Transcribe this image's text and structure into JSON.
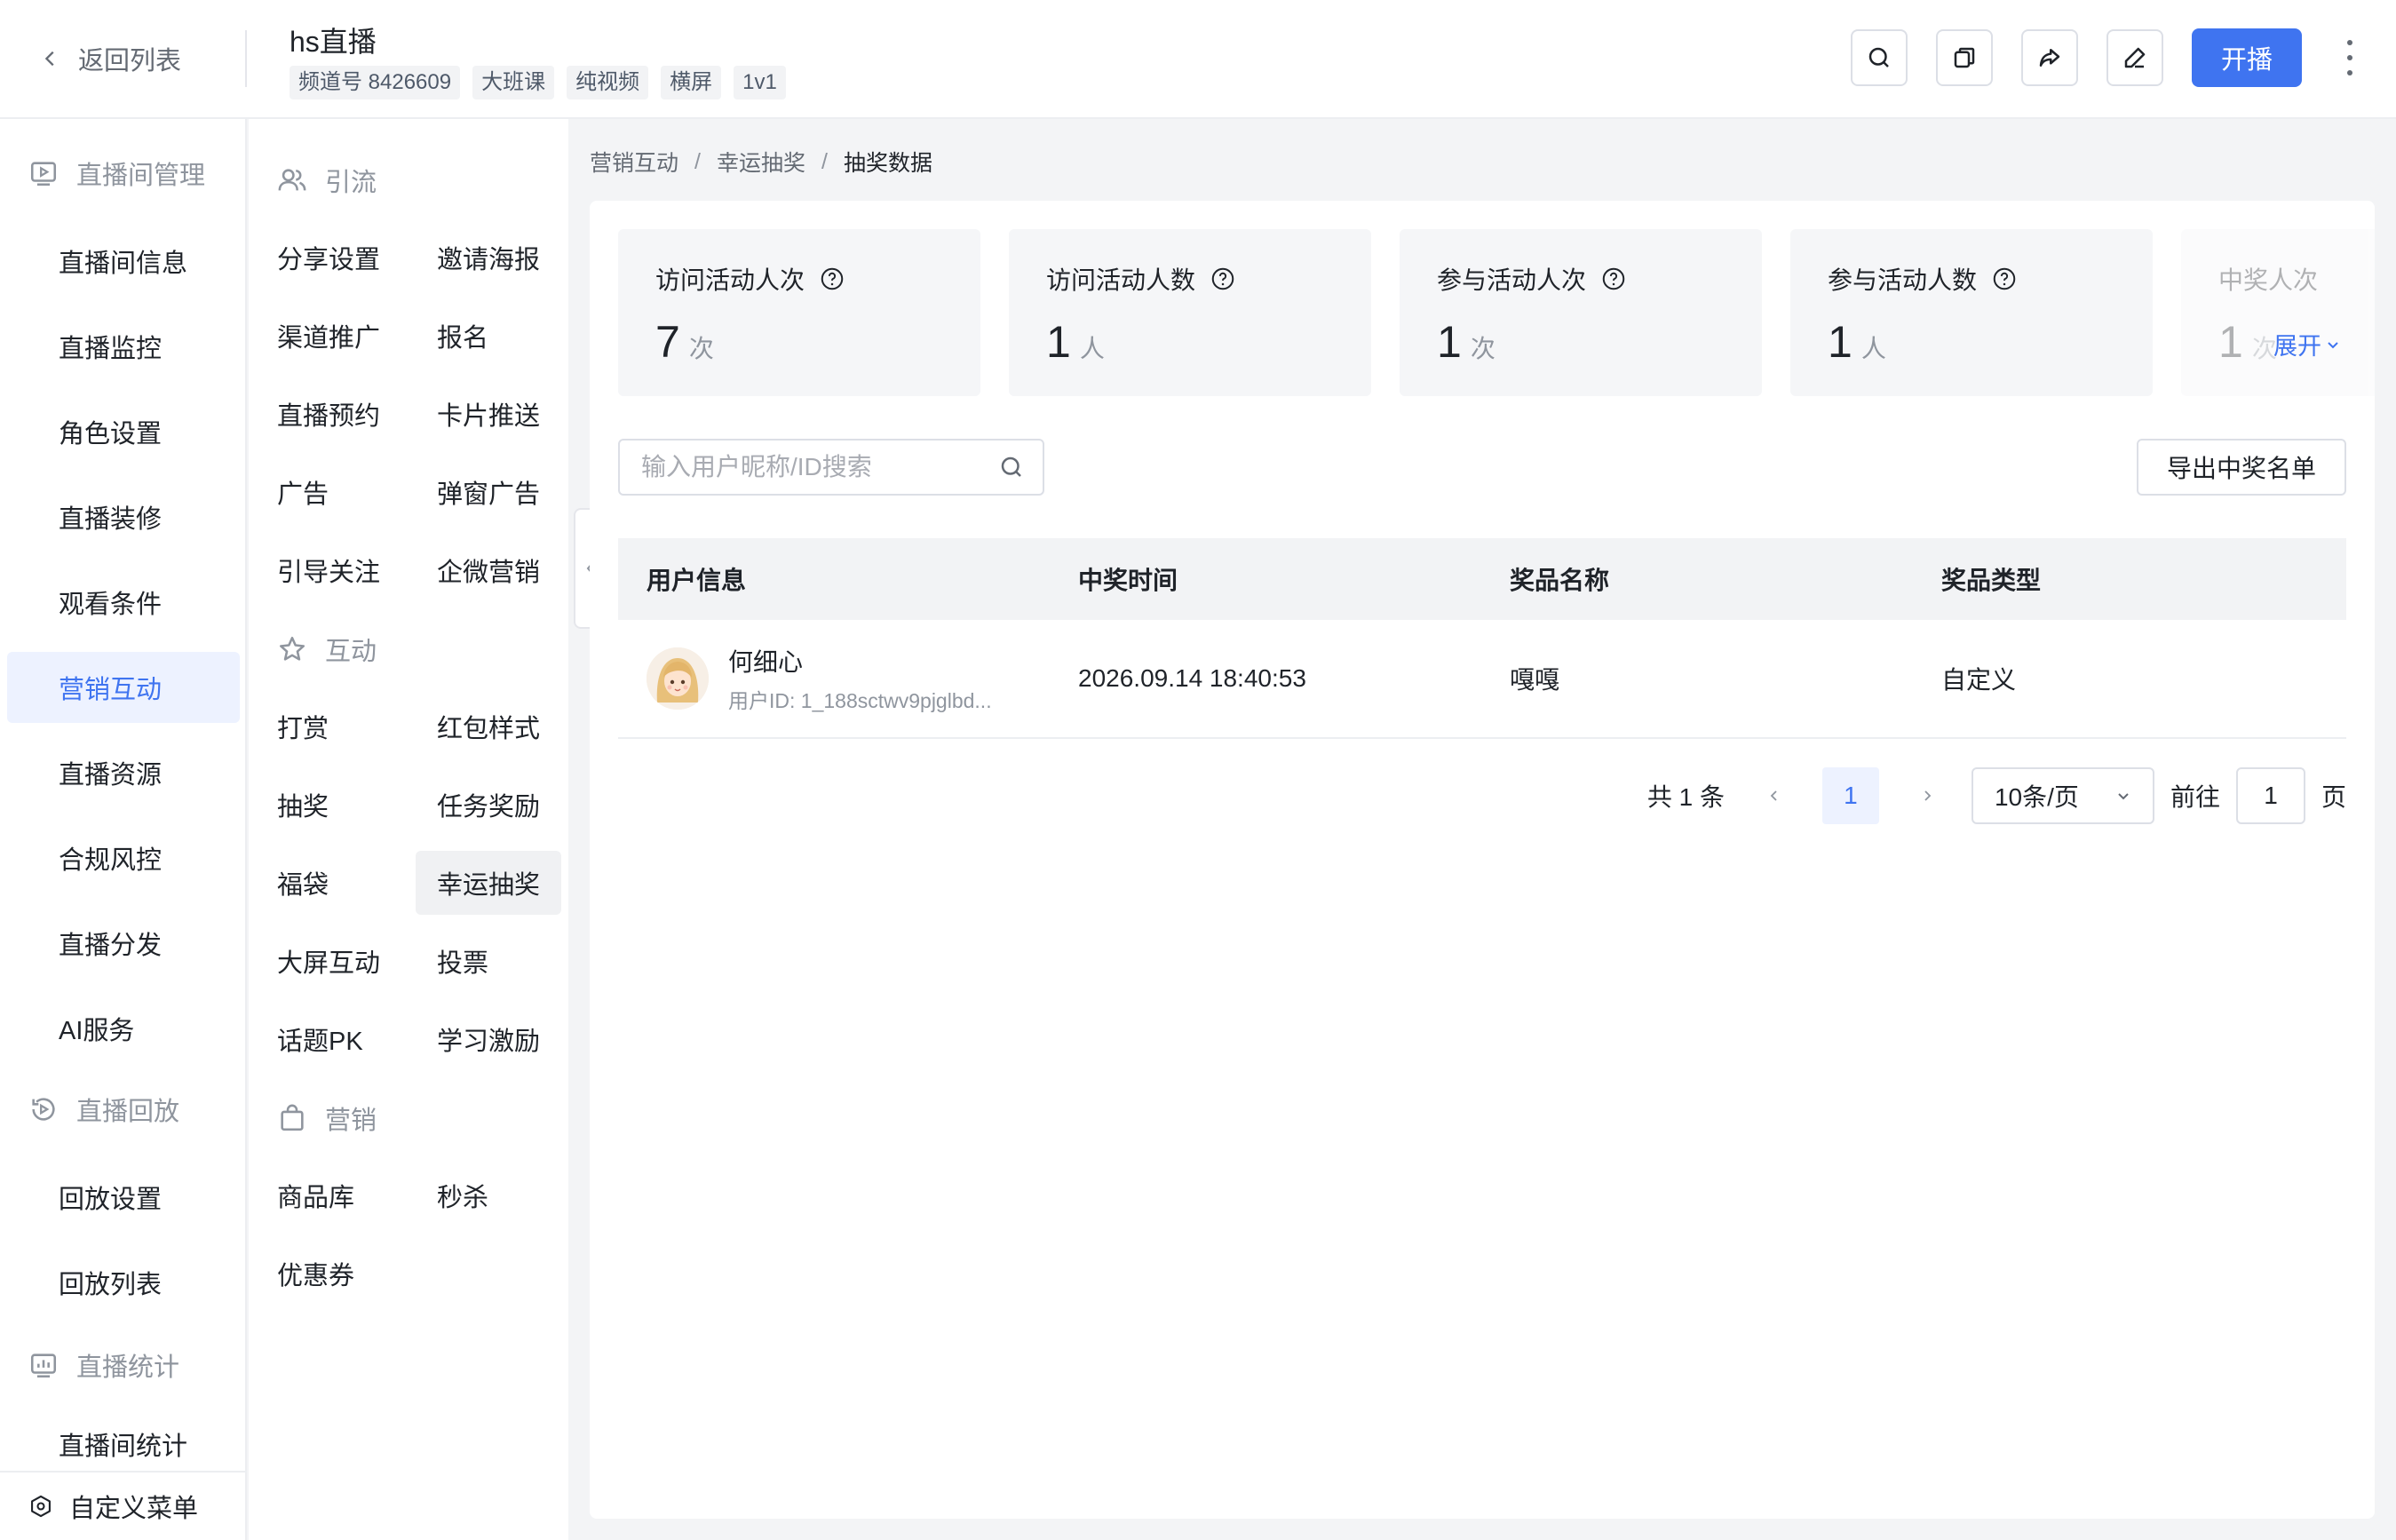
{
  "header": {
    "back_label": "返回列表",
    "title": "hs直播",
    "tags": [
      "频道号 8426609",
      "大班课",
      "纯视频",
      "横屏",
      "1v1"
    ],
    "live_button": "开播",
    "icons": [
      "search-icon",
      "copy-icon",
      "share-icon",
      "edit-icon",
      "more-vertical-icon"
    ]
  },
  "sidebar": {
    "groups": [
      {
        "label": "直播间管理",
        "icon": "play-screen-icon"
      },
      {
        "label": "直播回放",
        "icon": "replay-icon"
      },
      {
        "label": "直播统计",
        "icon": "stats-chart-icon"
      }
    ],
    "items": [
      "直播间信息",
      "直播监控",
      "角色设置",
      "直播装修",
      "观看条件",
      "营销互动",
      "直播资源",
      "合规风控",
      "直播分发",
      "AI服务"
    ],
    "replay_items": [
      "回放设置",
      "回放列表"
    ],
    "stats_items": [
      "直播间统计"
    ],
    "active": "营销互动",
    "custom_menu": "自定义菜单"
  },
  "submenu": {
    "groups": [
      {
        "label": "引流",
        "icon": "users-icon"
      },
      {
        "label": "互动",
        "icon": "star-icon"
      },
      {
        "label": "营销",
        "icon": "shopping-bag-icon"
      }
    ],
    "traffic": [
      "分享设置",
      "邀请海报",
      "渠道推广",
      "报名",
      "直播预约",
      "卡片推送",
      "广告",
      "弹窗广告",
      "引导关注",
      "企微营销"
    ],
    "interaction": [
      "打赏",
      "红包样式",
      "抽奖",
      "任务奖励",
      "福袋",
      "幸运抽奖",
      "大屏互动",
      "投票",
      "话题PK",
      "学习激励"
    ],
    "marketing": [
      "商品库",
      "秒杀",
      "优惠券"
    ],
    "active": "幸运抽奖"
  },
  "breadcrumb": [
    "营销互动",
    "幸运抽奖",
    "抽奖数据"
  ],
  "stats": [
    {
      "label": "访问活动人次",
      "value": "7",
      "unit": "次"
    },
    {
      "label": "访问活动人数",
      "value": "1",
      "unit": "人"
    },
    {
      "label": "参与活动人次",
      "value": "1",
      "unit": "次"
    },
    {
      "label": "参与活动人数",
      "value": "1",
      "unit": "人"
    },
    {
      "label": "中奖人次",
      "value": "1",
      "unit": "次"
    }
  ],
  "expand_label": "展开",
  "search": {
    "placeholder": "输入用户昵称/ID搜索",
    "value": ""
  },
  "export_button": "导出中奖名单",
  "table": {
    "columns": [
      "用户信息",
      "中奖时间",
      "奖品名称",
      "奖品类型"
    ],
    "rows": [
      {
        "name": "何细心",
        "user_id": "用户ID: 1_188sctwv9pjglbd...",
        "time": "2026.09.14 18:40:53",
        "prize": "嘎嘎",
        "prize_type": "自定义"
      }
    ]
  },
  "pagination": {
    "total": "共 1 条",
    "current_page": "1",
    "page_size": "10条/页",
    "goto_label": "前往",
    "goto_value": "1",
    "page_suffix": "页"
  },
  "colors": {
    "accent": "#3f74f0",
    "active_bg": "#edf2ff",
    "page_bg": "#f3f4f6"
  }
}
